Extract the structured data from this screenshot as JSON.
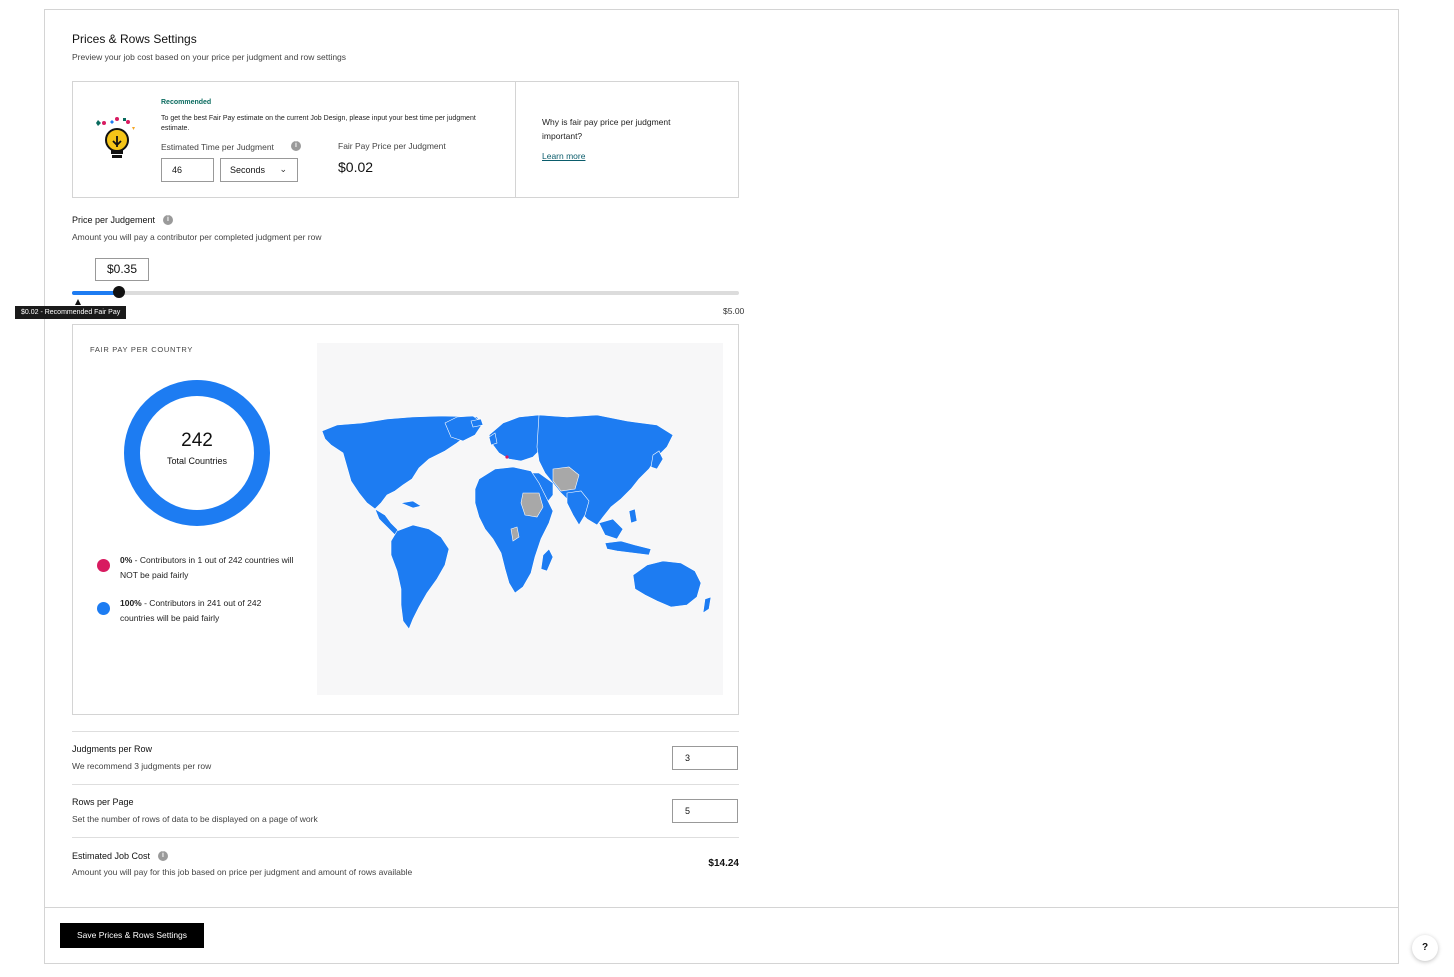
{
  "header": {
    "title": "Prices & Rows Settings",
    "subtitle": "Preview your job cost based on your price per judgment and row settings"
  },
  "recommendation": {
    "tag": "Recommended",
    "text": "To get the best Fair Pay estimate on the current Job Design, please input your best time per judgment estimate.",
    "time_label": "Estimated Time per Judgment",
    "time_value": "46",
    "time_unit": "Seconds",
    "fair_pay_label": "Fair Pay Price per Judgment",
    "fair_pay_value": "$0.02",
    "why_text": "Why is fair pay price per judgment important?",
    "learn_more": "Learn more"
  },
  "price_per_judgement": {
    "title": "Price per Judgement",
    "subtitle": "Amount you will pay a contributor per completed judgment per row",
    "value": "$0.35",
    "slider_fraction": 0.07,
    "max_label": "$5.00",
    "recommended_tooltip": "$0.02 - Recommended Fair Pay"
  },
  "fair_pay_country": {
    "title": "FAIR PAY PER COUNTRY",
    "total": "242",
    "total_label": "Total Countries",
    "unfair": {
      "pct": "0%",
      "text": " - Contributors in 1 out of 242 countries will NOT be paid fairly",
      "color": "#d81b60"
    },
    "fair": {
      "pct": "100%",
      "text": " - Contributors in 241 out of 242 countries will be paid fairly",
      "color": "#1d7cf2"
    }
  },
  "judgments_per_row": {
    "title": "Judgments per Row",
    "subtitle": "We recommend 3 judgments per row",
    "value": "3"
  },
  "rows_per_page": {
    "title": "Rows per Page",
    "subtitle": "Set the number of rows of data to be displayed on a page of work",
    "value": "5"
  },
  "job_cost": {
    "title": "Estimated Job Cost",
    "subtitle": "Amount you will pay for this job based on price per judgment and amount of rows available",
    "value": "$14.24"
  },
  "footer": {
    "save_label": "Save Prices & Rows Settings"
  },
  "help": {
    "label": "?"
  },
  "colors": {
    "accent": "#1d7cf2",
    "unfair": "#d81b60",
    "no_data": "#a8a8a8",
    "brand_link": "#0a5c6b"
  }
}
